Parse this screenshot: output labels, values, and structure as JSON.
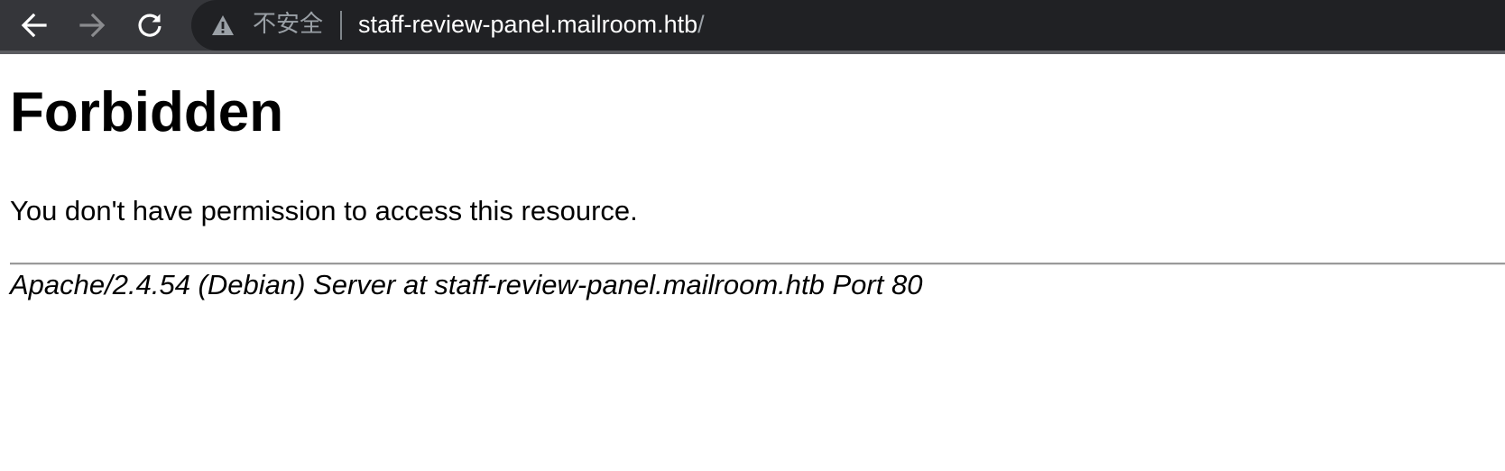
{
  "browser": {
    "back_icon": "arrow-left-icon",
    "forward_icon": "arrow-right-icon",
    "reload_icon": "reload-icon",
    "security_icon": "warning-triangle-icon",
    "security_label": "不安全",
    "url_host": "staff-review-panel.mailroom.htb",
    "url_path": "/",
    "colors": {
      "toolbar": "#35363a",
      "omnibox": "#202124",
      "url_host": "#ffffff",
      "muted": "#9aa0a6"
    }
  },
  "page": {
    "heading": "Forbidden",
    "message": "You don't have permission to access this resource.",
    "server_signature": "Apache/2.4.54 (Debian) Server at staff-review-panel.mailroom.htb Port 80"
  }
}
